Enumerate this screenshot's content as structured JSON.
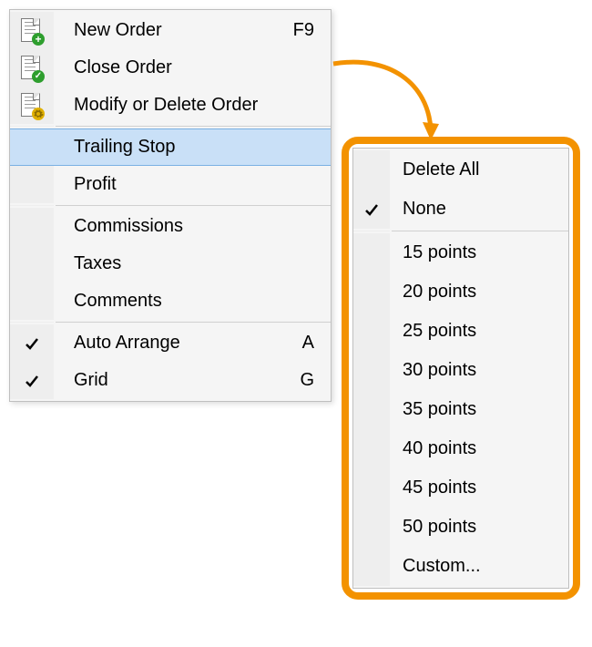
{
  "menu": {
    "items": [
      {
        "label": "New Order",
        "accel": "F9",
        "icon": "doc-add",
        "checked": false
      },
      {
        "label": "Close Order",
        "accel": "",
        "icon": "doc-ok",
        "checked": false
      },
      {
        "label": "Modify or Delete Order",
        "accel": "",
        "icon": "doc-gear",
        "checked": false
      }
    ],
    "items2": [
      {
        "label": "Trailing Stop",
        "accel": "",
        "highlight": true
      },
      {
        "label": "Profit",
        "accel": "",
        "highlight": false
      }
    ],
    "items3": [
      {
        "label": "Commissions",
        "accel": ""
      },
      {
        "label": "Taxes",
        "accel": ""
      },
      {
        "label": "Comments",
        "accel": ""
      }
    ],
    "items4": [
      {
        "label": "Auto Arrange",
        "accel": "A",
        "checked": true
      },
      {
        "label": "Grid",
        "accel": "G",
        "checked": true
      }
    ]
  },
  "submenu": {
    "top": [
      {
        "label": "Delete All",
        "checked": false
      },
      {
        "label": "None",
        "checked": true
      }
    ],
    "points": [
      {
        "label": "15 points"
      },
      {
        "label": "20 points"
      },
      {
        "label": "25 points"
      },
      {
        "label": "30 points"
      },
      {
        "label": "35 points"
      },
      {
        "label": "40 points"
      },
      {
        "label": "45 points"
      },
      {
        "label": "50 points"
      },
      {
        "label": "Custom..."
      }
    ]
  },
  "colors": {
    "accent": "#f39200",
    "highlight": "#c9e0f7"
  }
}
